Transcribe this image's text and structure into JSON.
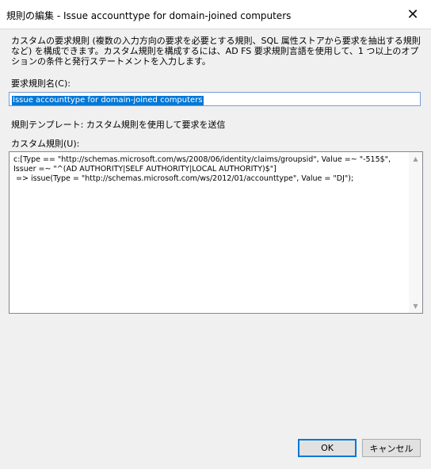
{
  "window": {
    "title": "規則の編集 - Issue accounttype for domain-joined computers",
    "close_glyph": "✕"
  },
  "description": "カスタムの要求規則 (複数の入力方向の要求を必要とする規則、SQL 属性ストアから要求を抽出する規則など) を構成できます。カスタム規則を構成するには、AD FS 要求規則言語を使用して、1 つ以上のオプションの条件と発行ステートメントを入力します。",
  "claim_rule_name": {
    "label": "要求規則名(C):",
    "value": "Issue accounttype for domain-joined computers"
  },
  "rule_template": "規則テンプレート: カスタム規則を使用して要求を送信",
  "custom_rule": {
    "label": "カスタム規則(U):",
    "text": "c:[Type == \"http://schemas.microsoft.com/ws/2008/06/identity/claims/groupsid\", Value =~ \"-515$\",\nIssuer =~ \"^(AD AUTHORITY|SELF AUTHORITY|LOCAL AUTHORITY)$\"]\n => issue(Type = \"http://schemas.microsoft.com/ws/2012/01/accounttype\", Value = \"DJ\");"
  },
  "buttons": {
    "ok": "OK",
    "cancel": "キャンセル"
  }
}
